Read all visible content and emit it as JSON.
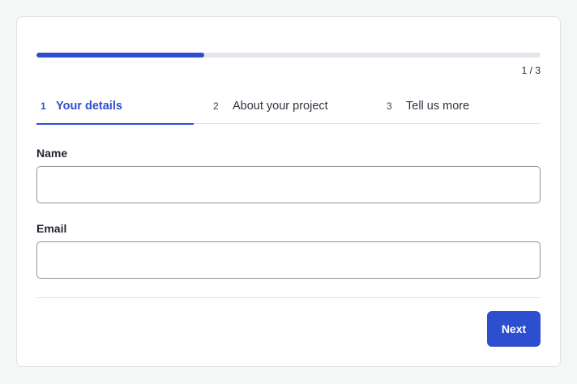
{
  "progress": {
    "fraction": 0.333,
    "count_text": "1 / 3"
  },
  "steps": [
    {
      "number": "1",
      "label": "Your details",
      "active": true
    },
    {
      "number": "2",
      "label": "About your project",
      "active": false
    },
    {
      "number": "3",
      "label": "Tell us more",
      "active": false
    }
  ],
  "form": {
    "name_label": "Name",
    "name_value": "",
    "email_label": "Email",
    "email_value": ""
  },
  "actions": {
    "next_label": "Next"
  },
  "colors": {
    "accent": "#2d4ecf",
    "track": "#e3e7ec",
    "background": "#f5f6f6"
  }
}
